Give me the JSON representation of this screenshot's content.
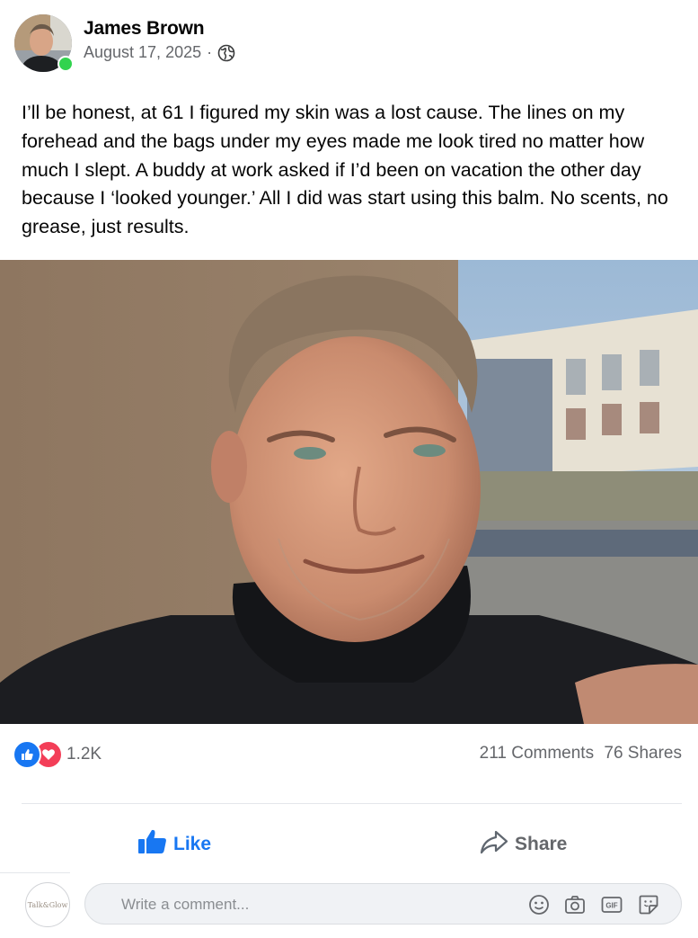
{
  "post": {
    "author": "James Brown",
    "date": "August 17, 2025",
    "separator": "·",
    "privacy_icon": "globe-icon",
    "author_online": true,
    "text": "I’ll be honest, at 61 I figured my skin was a lost cause. The lines on my forehead and the bags under my eyes made me look tired no matter how much I slept. A buddy at work asked if I’d been on vacation the other day because I ‘looked younger.’ All I did was start using this balm. No scents, no grease, just results."
  },
  "stats": {
    "reaction_icons": [
      "like-icon",
      "love-icon"
    ],
    "reaction_count": "1.2K",
    "comments": "211 Comments",
    "shares": "76 Shares"
  },
  "actions": {
    "like_label": "Like",
    "share_label": "Share"
  },
  "comment": {
    "avatar_text": "Talk&Glow",
    "placeholder": "Write a comment...",
    "tools": [
      "emoji-icon",
      "camera-icon",
      "gif-icon",
      "sticker-icon"
    ],
    "gif_label": "GIF"
  },
  "colors": {
    "accent": "#1877f2",
    "love": "#f33e58",
    "online": "#31d34e",
    "muted_text": "#65676b"
  }
}
